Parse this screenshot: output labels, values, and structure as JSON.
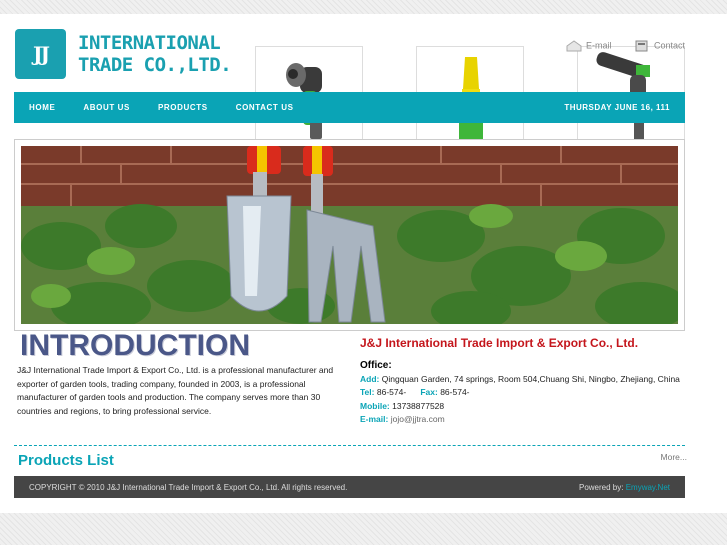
{
  "logo": {
    "mark": "JJ",
    "line1": "INTERNATIONAL",
    "line2": "TRADE  CO.,LTD."
  },
  "toplinks": {
    "email": "E-mail",
    "contact": "Contact"
  },
  "nav": {
    "items": [
      "HOME",
      "ABOUT US",
      "PRODUCTS",
      "CONTACT US"
    ],
    "date": "THURSDAY JUNE 16, 111"
  },
  "intro": {
    "title": "INTRODUCTION",
    "text": "J&J International Trade Import & Export Co., Ltd. is a professional manufacturer and exporter of garden tools, trading company, founded in 2003, is a professional manufacturer of garden tools and production. The company serves more than 30 countries and regions, to bring professional service."
  },
  "company": {
    "name": "J&J International Trade Import & Export Co., Ltd.",
    "office_label": "Office:",
    "add_label": "Add:",
    "add": "Qingquan Garden, 74 springs, Room 504,Chuang Shi, Ningbo, Zhejiang, China",
    "tel_label": "Tel:",
    "tel": "86-574-",
    "fax_label": "Fax:",
    "fax": "86-574-",
    "mobile_label": "Mobile:",
    "mobile": "13738877528",
    "email_label": "E-mail:",
    "email": "jojo@jjtra.com"
  },
  "products": {
    "title": "Products List",
    "more": "More..."
  },
  "footer": {
    "copyright": "COPYRIGHT © 2010 J&J International Trade Import & Export Co., Ltd. All rights reserved.",
    "powered_label": "Powered by:",
    "powered_link": "Emyway.Net"
  },
  "colors": {
    "accent": "#0aa4b6",
    "company_red": "#c4161c",
    "footer_bg": "#454545"
  },
  "icons": [
    "email-icon",
    "contact-icon"
  ]
}
